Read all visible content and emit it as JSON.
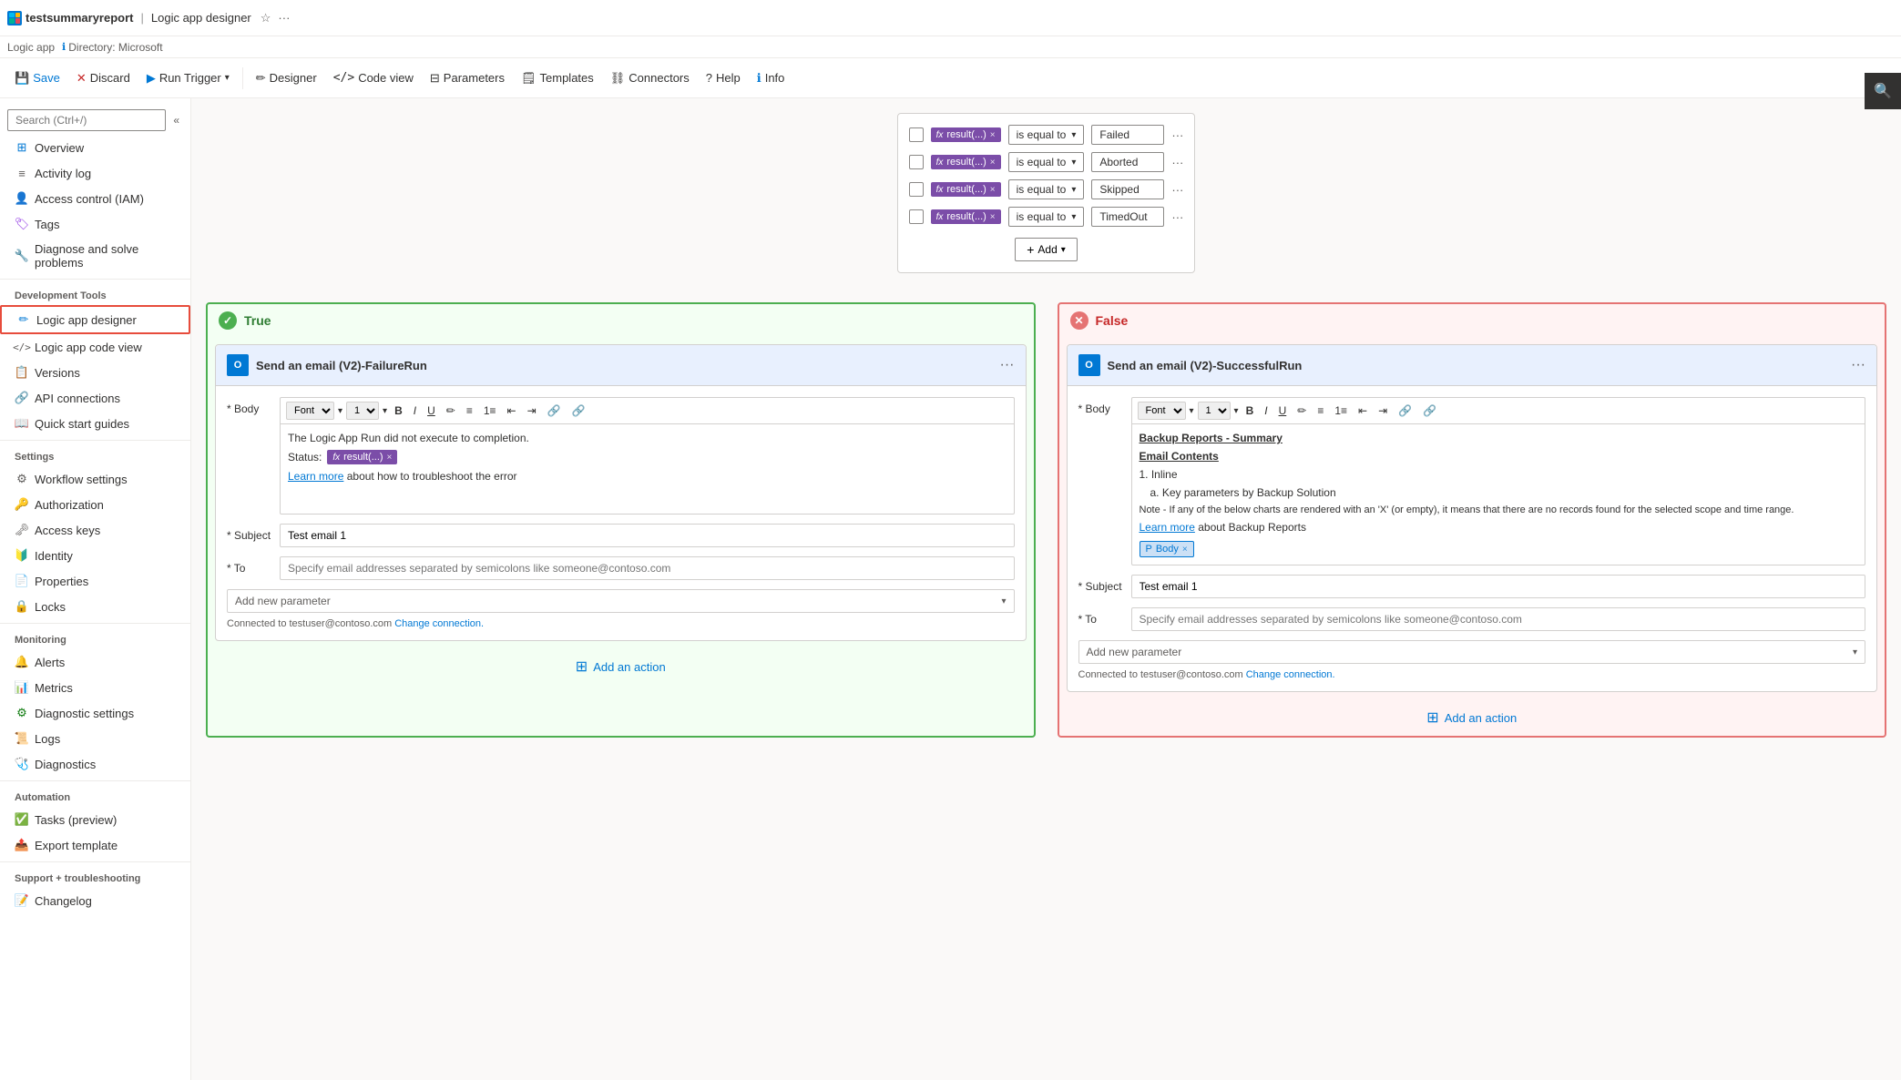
{
  "appTitle": "testsummaryreport",
  "appSeparator": "|",
  "designerTitle": "Logic app designer",
  "subtitleApp": "Logic app",
  "subtitleDir": "Directory: Microsoft",
  "toolbar": {
    "save": "Save",
    "discard": "Discard",
    "runTrigger": "Run Trigger",
    "designer": "Designer",
    "codeView": "Code view",
    "parameters": "Parameters",
    "templates": "Templates",
    "connectors": "Connectors",
    "help": "Help",
    "info": "Info"
  },
  "sidebar": {
    "searchPlaceholder": "Search (Ctrl+/)",
    "items": [
      {
        "id": "overview",
        "label": "Overview",
        "icon": "⊞"
      },
      {
        "id": "activity-log",
        "label": "Activity log",
        "icon": "≡"
      },
      {
        "id": "access-control",
        "label": "Access control (IAM)",
        "icon": "👤"
      },
      {
        "id": "tags",
        "label": "Tags",
        "icon": "🏷"
      },
      {
        "id": "diagnose",
        "label": "Diagnose and solve problems",
        "icon": "🔧"
      }
    ],
    "sections": {
      "developmentTools": {
        "label": "Development Tools",
        "items": [
          {
            "id": "logic-app-designer",
            "label": "Logic app designer",
            "icon": "✏",
            "active": true
          },
          {
            "id": "logic-app-code-view",
            "label": "Logic app code view",
            "icon": "</>"
          },
          {
            "id": "versions",
            "label": "Versions",
            "icon": "📋"
          },
          {
            "id": "api-connections",
            "label": "API connections",
            "icon": "🔗"
          },
          {
            "id": "quick-start",
            "label": "Quick start guides",
            "icon": "📖"
          }
        ]
      },
      "settings": {
        "label": "Settings",
        "items": [
          {
            "id": "workflow-settings",
            "label": "Workflow settings",
            "icon": "⚙"
          },
          {
            "id": "authorization",
            "label": "Authorization",
            "icon": "🔑"
          },
          {
            "id": "access-keys",
            "label": "Access keys",
            "icon": "🗝"
          },
          {
            "id": "identity",
            "label": "Identity",
            "icon": "🔰"
          },
          {
            "id": "properties",
            "label": "Properties",
            "icon": "📄"
          },
          {
            "id": "locks",
            "label": "Locks",
            "icon": "🔒"
          }
        ]
      },
      "monitoring": {
        "label": "Monitoring",
        "items": [
          {
            "id": "alerts",
            "label": "Alerts",
            "icon": "🔔"
          },
          {
            "id": "metrics",
            "label": "Metrics",
            "icon": "📊"
          },
          {
            "id": "diagnostic-settings",
            "label": "Diagnostic settings",
            "icon": "⚙"
          },
          {
            "id": "logs",
            "label": "Logs",
            "icon": "📜"
          },
          {
            "id": "diagnostics",
            "label": "Diagnostics",
            "icon": "🩺"
          }
        ]
      },
      "automation": {
        "label": "Automation",
        "items": [
          {
            "id": "tasks",
            "label": "Tasks (preview)",
            "icon": "✅"
          },
          {
            "id": "export-template",
            "label": "Export template",
            "icon": "📤"
          }
        ]
      },
      "support": {
        "label": "Support + troubleshooting",
        "items": [
          {
            "id": "changelog",
            "label": "Changelog",
            "icon": "📝"
          }
        ]
      }
    }
  },
  "canvas": {
    "conditionRows": [
      {
        "value": "Failed"
      },
      {
        "value": "Aborted"
      },
      {
        "value": "Skipped"
      },
      {
        "value": "TimedOut"
      }
    ],
    "conditionOp": "is equal to",
    "resultTag": "result(...)",
    "addLabel": "Add",
    "trueBranch": {
      "label": "True",
      "cardTitle": "Send an email (V2)-FailureRun",
      "bodyLabel": "* Body",
      "subjectLabel": "* Subject",
      "toLabel": "* To",
      "bodyText1": "The Logic App Run did not execute to completion.",
      "bodyText2": "Status:",
      "resultTag": "result(...)",
      "subjectValue": "Test email 1",
      "toPlaceholder": "Specify email addresses separated by semicolons like someone@contoso.com",
      "addParamLabel": "Add new parameter",
      "connectionText": "Connected to testuser@contoso.com",
      "changeConnection": "Change connection.",
      "addActionLabel": "Add an action"
    },
    "falseBranch": {
      "label": "False",
      "cardTitle": "Send an email (V2)-SuccessfulRun",
      "bodyLabel": "* Body",
      "subjectLabel": "* Subject",
      "toLabel": "* To",
      "backupTitle": "Backup Reports - Summary",
      "emailContents": "Email Contents",
      "item1": "1. Inline",
      "item1a": "a. Key parameters by Backup Solution",
      "noteText": "Note - If any of the below charts are rendered with an 'X' (or empty), it means that there are no records found for the selected scope and time range.",
      "learnMore": "Learn more",
      "learnMoreSuffix": "about Backup Reports",
      "bodyTag": "Body",
      "subjectValue": "Test email 1",
      "toPlaceholder": "Specify email addresses separated by semicolons like someone@contoso.com",
      "addParamLabel": "Add new parameter",
      "connectionText": "Connected to testuser@contoso.com",
      "changeConnection": "Change connection.",
      "addActionLabel": "Add an action"
    }
  }
}
